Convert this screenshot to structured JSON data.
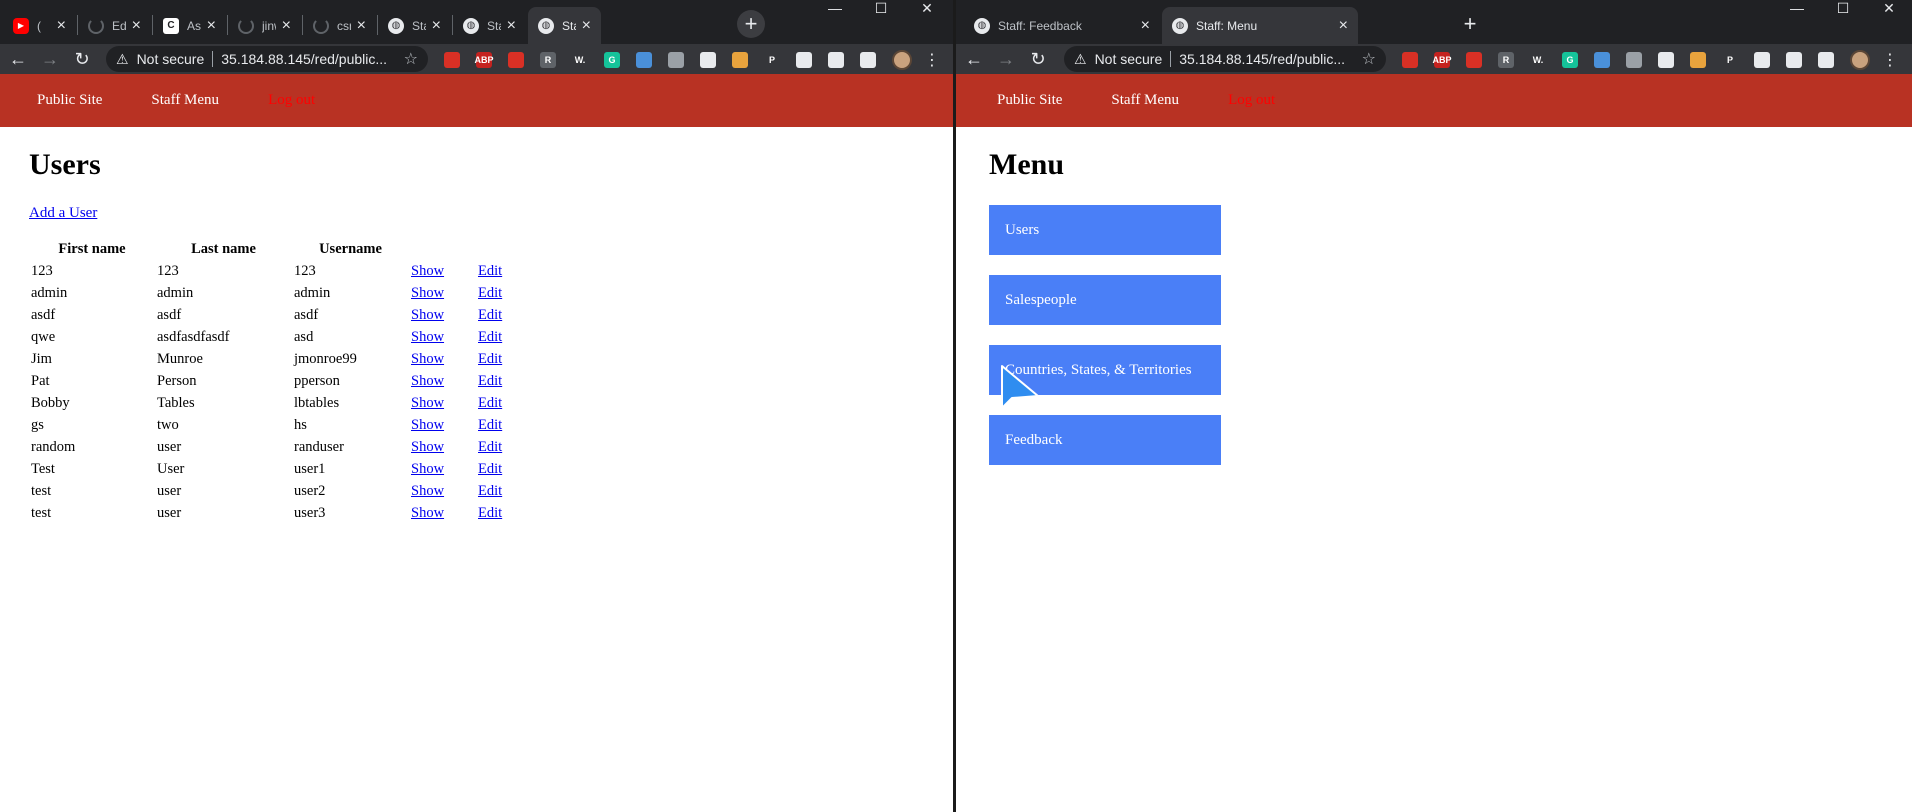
{
  "left_window": {
    "tabs": [
      {
        "title": "(",
        "favicon": "youtube-icon",
        "active": false
      },
      {
        "title": "Editi",
        "favicon": "spinner-icon",
        "active": false
      },
      {
        "title": "Assig",
        "favicon": "c-icon",
        "active": false
      },
      {
        "title": "jinwo",
        "favicon": "spinner-icon",
        "active": false
      },
      {
        "title": "csrftu",
        "favicon": "spinner-icon",
        "active": false
      },
      {
        "title": "Staff",
        "favicon": "globe-icon",
        "active": false
      },
      {
        "title": "Staff",
        "favicon": "globe-icon",
        "active": false
      },
      {
        "title": "Staff",
        "favicon": "globe-icon",
        "active": true
      }
    ],
    "omnibox": {
      "security": "Not secure",
      "url": "35.184.88.145/red/public..."
    },
    "nav": {
      "public_site": "Public Site",
      "staff_menu": "Staff Menu",
      "logout": "Log out"
    },
    "page": {
      "heading": "Users",
      "add_link": "Add a User",
      "columns": [
        "First name",
        "Last name",
        "Username"
      ],
      "show_label": "Show",
      "edit_label": "Edit",
      "rows": [
        [
          "123",
          "123",
          "123"
        ],
        [
          "admin",
          "admin",
          "admin"
        ],
        [
          "asdf",
          "asdf",
          "asdf"
        ],
        [
          "qwe",
          "asdfasdfasdf",
          "asd"
        ],
        [
          "Jim",
          "Munroe",
          "jmonroe99"
        ],
        [
          "Pat",
          "Person",
          "pperson"
        ],
        [
          "Bobby",
          "Tables",
          "lbtables"
        ],
        [
          "gs",
          "two",
          "hs"
        ],
        [
          "random",
          "user",
          "randuser"
        ],
        [
          "Test",
          "User",
          "user1"
        ],
        [
          "test",
          "user",
          "user2"
        ],
        [
          "test",
          "user",
          "user3"
        ]
      ]
    }
  },
  "right_window": {
    "tabs": [
      {
        "title": "Staff: Feedback",
        "favicon": "globe-icon",
        "active": false
      },
      {
        "title": "Staff: Menu",
        "favicon": "globe-icon",
        "active": true
      }
    ],
    "omnibox": {
      "security": "Not secure",
      "url": "35.184.88.145/red/public..."
    },
    "nav": {
      "public_site": "Public Site",
      "staff_menu": "Staff Menu",
      "logout": "Log out"
    },
    "page": {
      "heading": "Menu",
      "menu_items": [
        "Users",
        "Salespeople",
        "Countries, States, & Territories",
        "Feedback"
      ]
    }
  },
  "extensions": [
    {
      "name": "lock-ext-icon",
      "label": "",
      "color": "#d93025"
    },
    {
      "name": "adblock-icon",
      "label": "ABP",
      "color": "#c5221f"
    },
    {
      "name": "hand-ext-icon",
      "label": "",
      "color": "#d93025"
    },
    {
      "name": "r-ext-icon",
      "label": "R",
      "color": "#5f6368"
    },
    {
      "name": "w-ext-icon",
      "label": "W.",
      "color": "#35363a"
    },
    {
      "name": "grammarly-icon",
      "label": "G",
      "color": "#15c39a"
    },
    {
      "name": "compass-ext-icon",
      "label": "",
      "color": "#4a90d9"
    },
    {
      "name": "camera-ext-icon",
      "label": "",
      "color": "#9aa0a6"
    },
    {
      "name": "pocket-ext-icon",
      "label": "",
      "color": "#e8eaed"
    },
    {
      "name": "circle-ext-icon",
      "label": "",
      "color": "#e8a33d"
    },
    {
      "name": "p-ext-icon",
      "label": "P",
      "color": "#35363a"
    },
    {
      "name": "shield-ext-icon",
      "label": "",
      "color": "#e8eaed"
    },
    {
      "name": "puzzle-icon",
      "label": "",
      "color": "#e8eaed"
    },
    {
      "name": "media-icon",
      "label": "",
      "color": "#e8eaed"
    }
  ],
  "colors": {
    "navbar": "#b83223",
    "menu_button": "#4a7ff7",
    "logout": "#ff0000"
  }
}
